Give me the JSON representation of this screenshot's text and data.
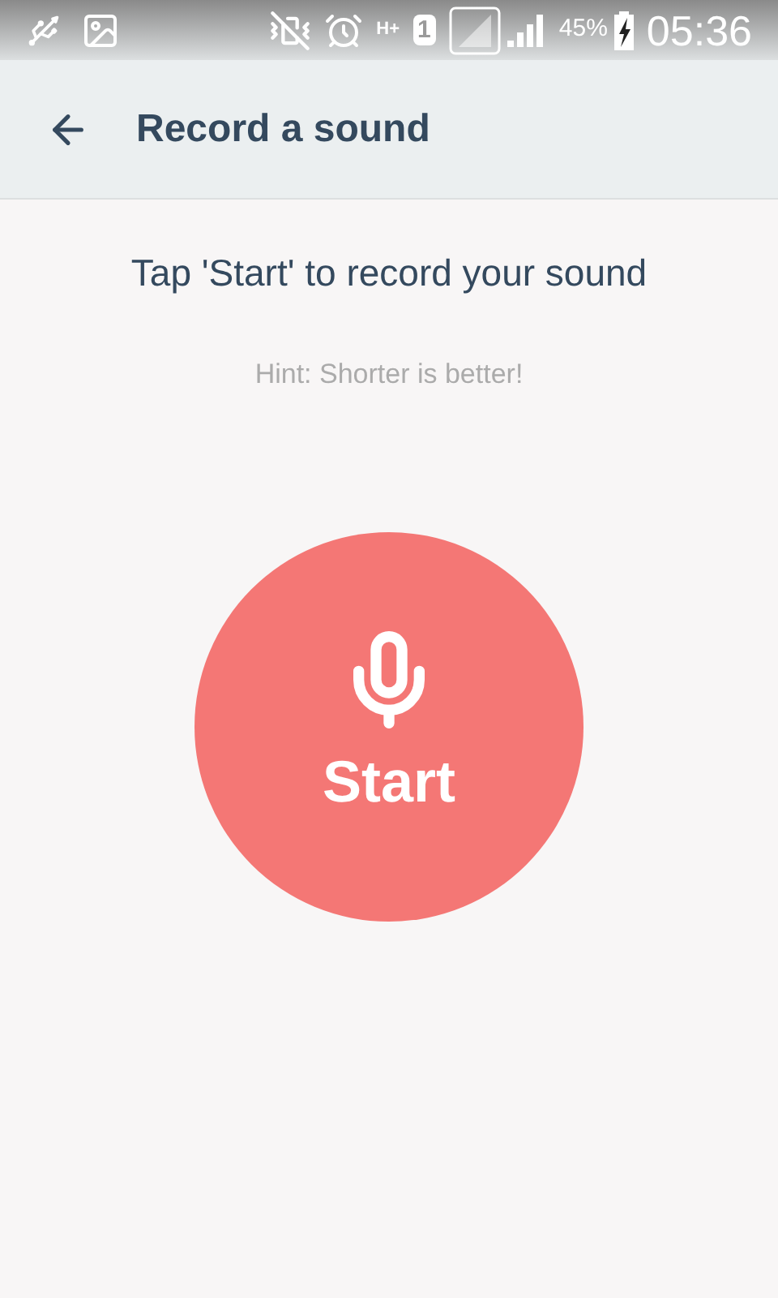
{
  "status_bar": {
    "network_type": "H+",
    "sim_slot": "1",
    "battery": "45%",
    "time": "05:36"
  },
  "app_bar": {
    "title": "Record a sound"
  },
  "instruction": "Tap 'Start' to record your sound",
  "hint": "Hint: Shorter is better!",
  "record_button": {
    "label": "Start"
  }
}
